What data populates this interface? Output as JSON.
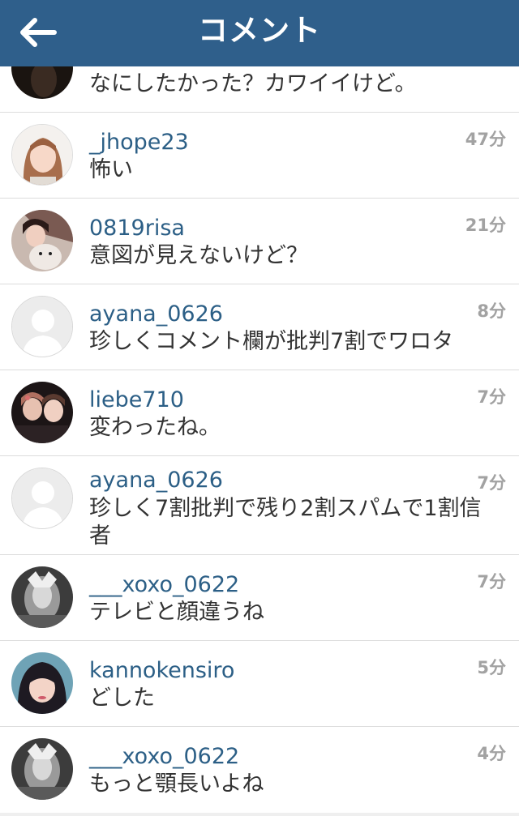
{
  "header": {
    "title": "コメント"
  },
  "first_comment": {
    "text": "なにしたかった？カワイイけど。"
  },
  "comments": [
    {
      "username": "_jhope23",
      "text": "怖い",
      "time": "47分"
    },
    {
      "username": "0819risa",
      "text": "意図が見えないけど？",
      "time": "21分"
    },
    {
      "username": "ayana_0626",
      "text": "珍しくコメント欄が批判7割でワロタ",
      "time": "8分"
    },
    {
      "username": "liebe710",
      "text": "変わったね。",
      "time": "7分"
    },
    {
      "username": "ayana_0626",
      "text": "珍しく7割批判で残り2割スパムで1割信者",
      "time": "7分"
    },
    {
      "username": "___xoxo_0622",
      "text": "テレビと顔違うね",
      "time": "7分"
    },
    {
      "username": "kannokensiro",
      "text": "どした",
      "time": "5分"
    },
    {
      "username": "___xoxo_0622",
      "text": "もっと顎長いよね",
      "time": "4分"
    }
  ],
  "icons": {
    "back": "arrow-left-icon",
    "default_avatar": "default-avatar-icon"
  },
  "colors": {
    "header_bg": "#2f5f8b",
    "username": "#2c5f86",
    "time": "#a2a2a2"
  }
}
